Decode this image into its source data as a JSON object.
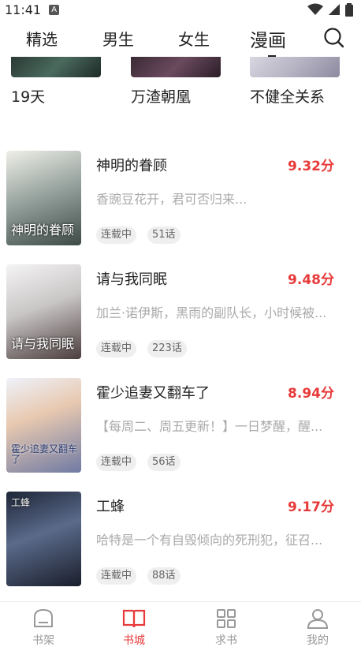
{
  "status_bar": {
    "time": "11:41",
    "notification_badge": "A"
  },
  "top_tabs": [
    {
      "label": "精选",
      "active": false
    },
    {
      "label": "男生",
      "active": false
    },
    {
      "label": "女生",
      "active": false
    },
    {
      "label": "漫画",
      "active": true
    }
  ],
  "top_row": [
    {
      "title": "19天",
      "cover_color": "#2b3a34"
    },
    {
      "title": "万渣朝凰",
      "cover_color": "#3a2a35"
    },
    {
      "title": "不健全关系",
      "cover_color": "#d8d6e0"
    }
  ],
  "books": [
    {
      "title": "神明的眷顾",
      "score": "9.32分",
      "description": "香豌豆花开，君可否归来...",
      "status": "连载中",
      "chapters": "51话",
      "cover_text": "神明的眷顾",
      "cover_bg": "#5d6a64"
    },
    {
      "title": "请与我同眠",
      "score": "9.48分",
      "description": "加兰·诺伊斯，黑雨的副队长，小时候被...",
      "status": "连载中",
      "chapters": "223话",
      "cover_text": "请与我同眠",
      "cover_bg": "#d9d6d6"
    },
    {
      "title": "霍少追妻又翻车了",
      "score": "8.94分",
      "description": "【每周二、周五更新！】一日梦醒，醒...",
      "status": "连载中",
      "chapters": "56话",
      "cover_text": "霍少追妻又翻车了",
      "cover_bg": "#cfd7e8"
    },
    {
      "title": "工蜂",
      "score": "9.17分",
      "description": "哈特是一个有自毁倾向的死刑犯，征召...",
      "status": "连载中",
      "chapters": "88话",
      "cover_text": "工蜂",
      "cover_bg": "#2d3347"
    }
  ],
  "bottom_nav": [
    {
      "label": "书架",
      "icon": "bookshelf-icon",
      "active": false
    },
    {
      "label": "书城",
      "icon": "book-open-icon",
      "active": true
    },
    {
      "label": "求书",
      "icon": "grid-icon",
      "active": false
    },
    {
      "label": "我的",
      "icon": "user-icon",
      "active": false
    }
  ],
  "colors": {
    "accent": "#e83a3a",
    "muted": "#aaaaaa",
    "tag_bg": "#efefef"
  }
}
